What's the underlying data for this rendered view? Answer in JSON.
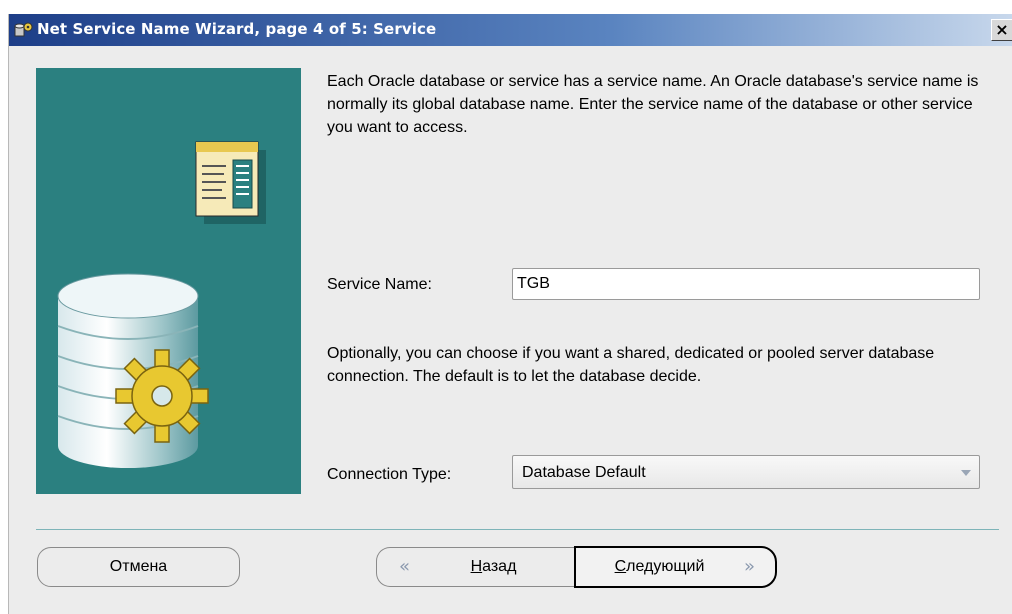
{
  "window": {
    "title": "Net Service Name Wizard, page 4 of 5: Service",
    "close_label": "×"
  },
  "main": {
    "description": "Each Oracle database or service has a service name. An Oracle database's service name is normally its global database name. Enter the service name of the database or other service you want to access.",
    "service_name_label": "Service Name:",
    "service_name_value": "TGB",
    "connection_description": "Optionally, you can choose if you want a shared, dedicated or pooled server database connection. The default is to let the database decide.",
    "connection_type_label": "Connection Type:",
    "connection_type_value": "Database Default"
  },
  "buttons": {
    "cancel": "Отмена",
    "back_first": "Н",
    "back_rest": "азад",
    "next_first": "С",
    "next_rest": "ледующий",
    "back_chevron": "«",
    "next_chevron": "»"
  },
  "colors": {
    "panel": "#2b8080",
    "divider": "#7eb4b8",
    "title_bar": "#1d3e88"
  },
  "icons": [
    "wizard-app-icon",
    "document-icon",
    "database-icon",
    "gear-icon",
    "chevron-left-icon",
    "chevron-right-icon"
  ]
}
